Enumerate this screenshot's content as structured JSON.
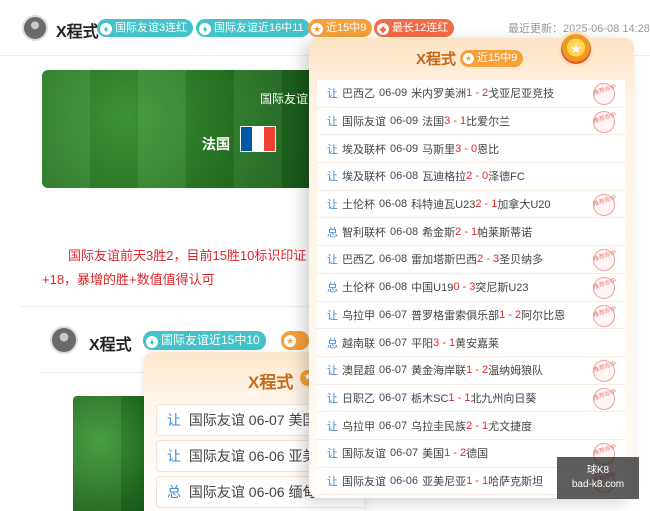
{
  "header": {
    "author": "X程式",
    "badges": [
      {
        "icon": "flame-icon",
        "glyph": "♦",
        "text": "国际友谊3连红",
        "color": "#43c3c9"
      },
      {
        "icon": "flame-icon",
        "glyph": "♦",
        "text": "国际友谊近16中11",
        "color": "#43c3c9"
      },
      {
        "icon": "star-icon",
        "glyph": "★",
        "text": "近15中9",
        "color": "#f7a13a"
      },
      {
        "icon": "trophy-icon",
        "glyph": "◆",
        "text": "最长12连红",
        "color": "#f26c46"
      }
    ],
    "update_text": "最近更新：2025-06-08 14:28"
  },
  "article": {
    "match_title": "国际友谊",
    "team": "法国",
    "flag_colors": [
      "#0055a4",
      "#ffffff",
      "#ef4135"
    ],
    "line1": "国际友谊前天3胜2，目前15胜10标识印证",
    "line2": "+18，暴增的胜+数值值得认可"
  },
  "second_post": {
    "author": "X程式",
    "badge": "国际友谊近15中10"
  },
  "back_popup": {
    "title": "X程式",
    "rows": [
      {
        "tag": "让",
        "text": "国际友谊 06-07 美国"
      },
      {
        "tag": "让",
        "text": "国际友谊 06-06 亚美"
      },
      {
        "tag": "总",
        "text": "国际友谊 06-06 缅甸"
      }
    ]
  },
  "popup": {
    "title": "X程式",
    "badge": "近15中9",
    "stamp_text": "推荐命中",
    "rows": [
      {
        "tag": "让",
        "league": "巴西乙",
        "date": "06-09",
        "home": "米内罗美洲",
        "score": "1 - 2",
        "away": "戈亚尼亚竞技",
        "hit": true
      },
      {
        "tag": "让",
        "league": "国际友谊",
        "date": "06-09",
        "home": "法国",
        "score": "3 - 1",
        "away": "比爱尔兰",
        "hit": true
      },
      {
        "tag": "让",
        "league": "埃及联杯",
        "date": "06-09",
        "home": "马斯里",
        "score": "3 - 0",
        "away": "恩比",
        "hit": false
      },
      {
        "tag": "让",
        "league": "埃及联杯",
        "date": "06-08",
        "home": "瓦迪格拉",
        "score": "2 - 0",
        "away": "泽德FC",
        "hit": false
      },
      {
        "tag": "让",
        "league": "土伦杯",
        "date": "06-08",
        "home": "科特迪瓦U23",
        "score": "2 - 1",
        "away": "加拿大U20",
        "hit": true
      },
      {
        "tag": "总",
        "league": "智利联杯",
        "date": "06-08",
        "home": "希金斯",
        "score": "2 - 1",
        "away": "帕莱斯蒂诺",
        "hit": false
      },
      {
        "tag": "让",
        "league": "巴西乙",
        "date": "06-08",
        "home": "雷加塔斯巴西",
        "score": "2 - 3",
        "away": "圣贝纳多",
        "hit": true
      },
      {
        "tag": "总",
        "league": "土伦杯",
        "date": "06-08",
        "home": "中国U19",
        "score": "0 - 3",
        "away": "突尼斯U23",
        "hit": true
      },
      {
        "tag": "让",
        "league": "乌拉甲",
        "date": "06-07",
        "home": "普罗格雷索俱乐部",
        "score": "1 - 2",
        "away": "阿尔比恩",
        "hit": true
      },
      {
        "tag": "总",
        "league": "越南联",
        "date": "06-07",
        "home": "平阳",
        "score": "3 - 1",
        "away": "黄安嘉莱",
        "hit": false
      },
      {
        "tag": "让",
        "league": "澳昆超",
        "date": "06-07",
        "home": "黄金海岸联",
        "score": "1 - 2",
        "away": "温纳姆狼队",
        "hit": true
      },
      {
        "tag": "让",
        "league": "日职乙",
        "date": "06-07",
        "home": "栃木SC",
        "score": "1 - 1",
        "away": "北九州向日葵",
        "hit": true
      },
      {
        "tag": "让",
        "league": "乌拉甲",
        "date": "06-07",
        "home": "乌拉圭民族",
        "score": "2 - 1",
        "away": "尤文捷度",
        "hit": false
      },
      {
        "tag": "让",
        "league": "国际友谊",
        "date": "06-07",
        "home": "美国",
        "score": "1 - 2",
        "away": "德国",
        "hit": true
      },
      {
        "tag": "让",
        "league": "国际友谊",
        "date": "06-06",
        "home": "亚美尼亚",
        "score": "1 - 1",
        "away": "哈萨克斯坦",
        "hit": true
      }
    ]
  },
  "watermark": {
    "line1": "球K8",
    "line2": "bad-k8.com"
  }
}
